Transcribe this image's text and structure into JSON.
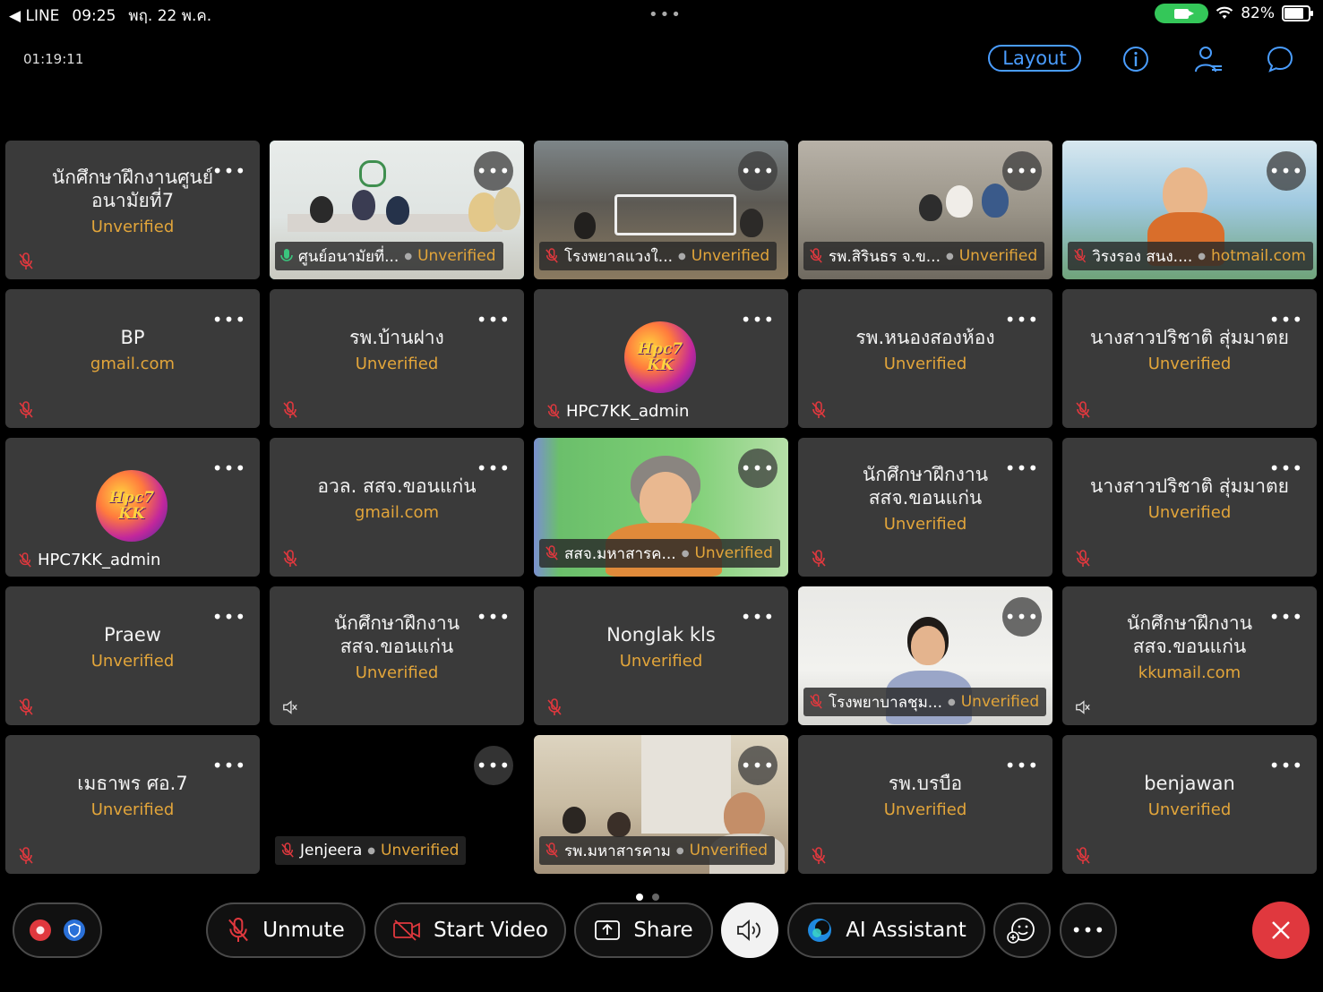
{
  "status_bar": {
    "back_app": "◀ LINE",
    "time": "09:25",
    "date": "พฤ. 22 พ.ค.",
    "battery": "82%"
  },
  "header": {
    "elapsed": "01:19:11",
    "layout_label": "Layout"
  },
  "tiles": [
    {
      "name": "นักศึกษาฝึกงานศูนย์อนามัยที่7",
      "sub": "Unverified"
    },
    {
      "name": "ศูนย์อนามัยที่...",
      "sub": "Unverified"
    },
    {
      "name": "โรงพยาลแวงใ...",
      "sub": "Unverified"
    },
    {
      "name": "รพ.สิรินธร จ.ข...",
      "sub": "Unverified"
    },
    {
      "name": "วิรงรอง สนง....",
      "sub": "hotmail.com"
    },
    {
      "name": "BP",
      "sub": "gmail.com"
    },
    {
      "name": "รพ.บ้านฝาง",
      "sub": "Unverified"
    },
    {
      "name": "HPC7KK_admin",
      "sub": ""
    },
    {
      "name": "รพ.หนองสองห้อง",
      "sub": "Unverified"
    },
    {
      "name": "นางสาวปริชาติ  สุ่มมาตย",
      "sub": "Unverified"
    },
    {
      "name": "HPC7KK_admin",
      "sub": ""
    },
    {
      "name": "อวล. สสจ.ขอนแก่น",
      "sub": "gmail.com"
    },
    {
      "name": "สสจ.มหาสารค...",
      "sub": "Unverified"
    },
    {
      "name": "นักศึกษาฝึกงาน สสจ.ขอนแก่น",
      "sub": "Unverified"
    },
    {
      "name": "นางสาวปริชาติ  สุ่มมาตย",
      "sub": "Unverified"
    },
    {
      "name": "Praew",
      "sub": "Unverified"
    },
    {
      "name": "นักศึกษาฝึกงาน สสจ.ขอนแก่น",
      "sub": "Unverified"
    },
    {
      "name": "Nonglak kls",
      "sub": "Unverified"
    },
    {
      "name": "โรงพยาบาลชุม...",
      "sub": "Unverified"
    },
    {
      "name": "นักศึกษาฝึกงาน สสจ.ขอนแก่น",
      "sub": "kkumail.com"
    },
    {
      "name": "เมธาพร ศอ.7",
      "sub": "Unverified"
    },
    {
      "name": "Jenjeera",
      "sub": "Unverified"
    },
    {
      "name": "รพ.มหาสารคาม",
      "sub": "Unverified"
    },
    {
      "name": "รพ.บรบือ",
      "sub": "Unverified"
    },
    {
      "name": "benjawan",
      "sub": "Unverified"
    }
  ],
  "logo_text": [
    "Hpc7",
    "KK"
  ],
  "more_label": "•••",
  "toolbar": {
    "unmute": "Unmute",
    "start_video": "Start Video",
    "share": "Share",
    "ai_assistant": "AI Assistant",
    "more": "•••"
  },
  "colors": {
    "accent_blue": "#4a9dff",
    "unverified_orange": "#e2a53a",
    "end_call_red": "#e0383e",
    "active_speaker": "#43c9c0"
  }
}
